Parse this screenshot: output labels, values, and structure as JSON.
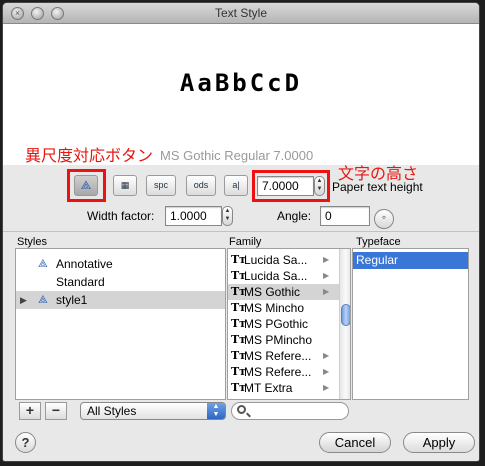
{
  "window": {
    "title": "Text Style"
  },
  "preview": {
    "sample": "AaBbCcD",
    "font_info": "MS Gothic   Regular   7.0000"
  },
  "annotations": {
    "annotative_button_note": "異尺度対応ボタン",
    "height_note": "文字の高さ"
  },
  "toolbar": {
    "buttons": [
      {
        "name": "annotative",
        "glyph": "⟁"
      },
      {
        "name": "background",
        "glyph": "▦"
      },
      {
        "name": "spacing",
        "glyph": "spc"
      },
      {
        "name": "oblique",
        "glyph": "ods"
      },
      {
        "name": "vertical",
        "glyph": "a|"
      }
    ],
    "height_value": "7.0000",
    "height_label": "Paper text height"
  },
  "width_factor": {
    "label": "Width factor:",
    "value": "1.0000"
  },
  "angle": {
    "label": "Angle:",
    "value": "0"
  },
  "styles": {
    "header": "Styles",
    "items": [
      {
        "label": "Annotative",
        "annotative": true,
        "expanded": false
      },
      {
        "label": "Standard",
        "annotative": false,
        "expanded": false
      },
      {
        "label": "style1",
        "annotative": true,
        "expanded": true,
        "selected": true
      }
    ]
  },
  "family": {
    "header": "Family",
    "items": [
      "Lucida Sa...",
      "Lucida Sa...",
      "MS Gothic",
      "MS Mincho",
      "MS PGothic",
      "MS PMincho",
      "MS Refere...",
      "MS Refere...",
      "MT Extra"
    ],
    "selected": "MS Gothic"
  },
  "typeface": {
    "header": "Typeface",
    "items": [
      "Regular"
    ],
    "selected": "Regular"
  },
  "bottom": {
    "add": "+",
    "remove": "−",
    "filter": "All Styles"
  },
  "buttons": {
    "help": "?",
    "cancel": "Cancel",
    "apply": "Apply"
  },
  "colors": {
    "annotation_red": "#e6170f",
    "selection_blue": "#3a76d6"
  }
}
